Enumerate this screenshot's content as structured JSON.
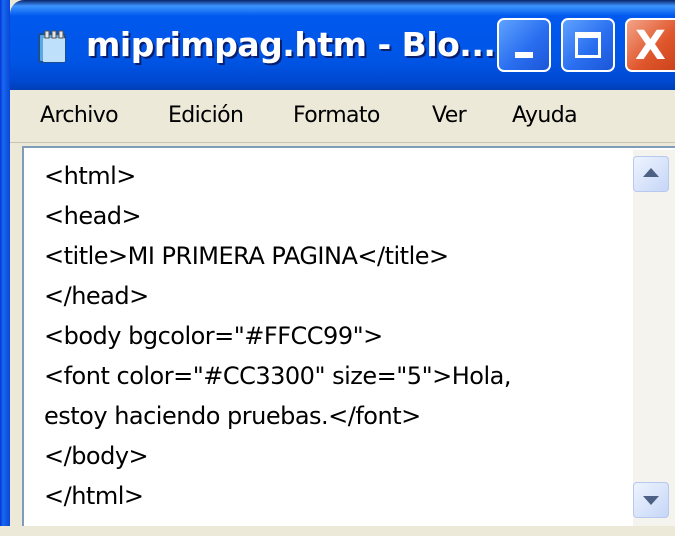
{
  "window": {
    "title": "miprimpag.htm - Blo...",
    "icon": "notepad-icon",
    "controls": {
      "minimize": "minimize-icon",
      "maximize": "maximize-icon",
      "close": "close-icon",
      "close_glyph": "X"
    }
  },
  "menu": {
    "items": [
      "Archivo",
      "Edición",
      "Formato",
      "Ver",
      "Ayuda"
    ]
  },
  "editor": {
    "lines": [
      "<html>",
      "<head>",
      "<title>MI PRIMERA PAGINA</title>",
      "</head>",
      "<body bgcolor=\"#FFCC99\">",
      "<font color=\"#CC3300\" size=\"5\">Hola,",
      "estoy haciendo pruebas.</font>",
      "</body>",
      "</html>"
    ]
  },
  "scrollbar": {
    "up_icon": "scroll-up-arrow-icon",
    "down_icon": "scroll-down-arrow-icon"
  },
  "colors": {
    "titlebar": "#0055e5",
    "close_button": "#e0572d",
    "menu_bg": "#ece9d8",
    "editor_bg": "#ffffff"
  }
}
